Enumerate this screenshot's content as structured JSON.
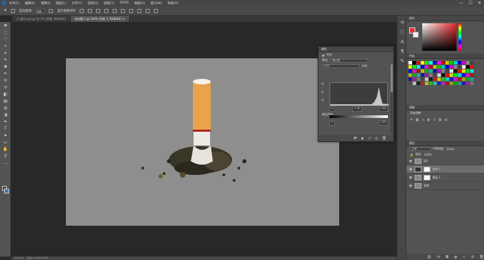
{
  "menu": {
    "items": [
      "文件(F)",
      "编辑(E)",
      "图像(I)",
      "图层(L)",
      "文字(Y)",
      "选择(S)",
      "滤镜(T)",
      "3D(D)",
      "视图(V)",
      "窗口(W)",
      "帮助(H)"
    ],
    "min": "—",
    "max": "☐",
    "close": "✕"
  },
  "options": {
    "auto_select": "自动选择:",
    "auto_select_value": "图层",
    "show_transform": "显示变换控件"
  },
  "tabs": [
    {
      "label": "大 烟头.psd @ 16.7% (背景, RGB/8#)"
    },
    {
      "label": "未标题-1 @ 100% (色阶 1, RGB/8#) ✕"
    }
  ],
  "status": {
    "zoom": "16.67%",
    "doc_info": "文档:1.21M/5.30M"
  },
  "panels": {
    "color_tab": "颜色",
    "swatches_tab": "色板",
    "adjust_tab": "调整",
    "adjust_add": "添加调整",
    "layers_tab": "图层",
    "levels_tab": "属性"
  },
  "levels": {
    "title": "色阶",
    "preset_label": "预设:",
    "preset_value": "默认值",
    "channel_value": "RGB",
    "auto": "自动",
    "input_black": "0",
    "input_gray": "1.00",
    "input_white": "255",
    "output_label": "输出色阶:",
    "output_black": "0",
    "output_white": "255"
  },
  "layers": {
    "blend_mode": "正常",
    "opacity_label": "不透明度:",
    "opacity_value": "100%",
    "fill_label": "填充:",
    "fill_value": "100%",
    "rows": [
      {
        "name": "组1"
      },
      {
        "name": "色阶 1"
      },
      {
        "name": "图层 1"
      },
      {
        "name": "背景"
      }
    ]
  },
  "colors": {
    "foreground": "#e0302f",
    "background": "#f0f0f0",
    "tool_fg": "#4a4a4a",
    "tool_bg": "#2f7cc9",
    "canvas": "#8e8e8e"
  }
}
